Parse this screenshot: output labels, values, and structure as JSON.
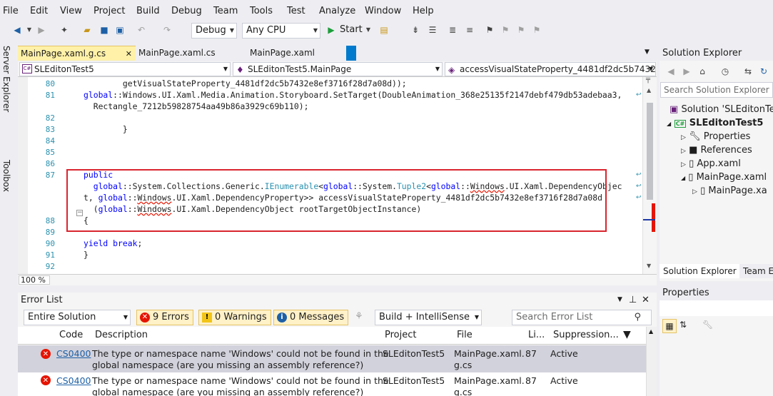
{
  "menu": [
    "File",
    "Edit",
    "View",
    "Project",
    "Build",
    "Debug",
    "Team",
    "Tools",
    "Test",
    "Analyze",
    "Window",
    "Help"
  ],
  "toolbar": {
    "config": "Debug",
    "platform": "Any CPU",
    "start_label": "Start"
  },
  "sidebar": {
    "server_explorer": "Server Explorer",
    "toolbox": "Toolbox"
  },
  "tabs": [
    "MainPage.xaml.g.cs",
    "MainPage.xaml.cs",
    "MainPage.xaml"
  ],
  "nav": {
    "project": "SLEditonTest5",
    "class": "SLEditonTest5.MainPage",
    "member": "accessVisualStateProperty_4481df2dc5b7432"
  },
  "code": {
    "line_numbers": [
      "80",
      "81",
      "82",
      "83",
      "84",
      "85",
      "86",
      "87",
      "88",
      "89",
      "90",
      "91",
      "92"
    ],
    "l80": "        getVisualStateProperty_4481df2dc5b7432e8ef3716f28d7a08d));",
    "l81a_global": "global",
    "l81a_rest": "::Windows.UI.Xaml.Media.Animation.Storyboard.SetTarget(DoubleAnimation_368e25135f2147debf479db53adebaa3,",
    "l81b": "  Rectangle_7212b59828754aa49b86a3929c69b110);",
    "l83": "        }",
    "l87_public": "public",
    "l87b_global1": "global",
    "l87b_mid1": "::System.Collections.Generic.",
    "l87b_ienum": "IEnumerable",
    "l87b_lt": "<",
    "l87b_global2": "global",
    "l87b_mid2": "::System.",
    "l87b_tuple": "Tuple2",
    "l87b_lt2": "<",
    "l87b_global3": "global",
    "l87b_mid3": "::",
    "l87b_windows": "Windows",
    "l87b_tail": ".UI.Xaml.DependencyObjec",
    "l87c_t": "t, ",
    "l87c_global": "global",
    "l87c_mid": "::",
    "l87c_windows": "Windows",
    "l87c_tail": ".UI.Xaml.DependencyProperty>> accessVisualStateProperty_4481df2dc5b7432e8ef3716f28d7a08d",
    "l87d_open": "(",
    "l87d_global": "global",
    "l87d_mid": "::",
    "l87d_windows": "Windows",
    "l87d_tail": ".UI.Xaml.DependencyObject rootTargetObjectInstance)",
    "l88": "{",
    "l90_yield": "yield",
    "l90_break": "break",
    "l90_semi": ";",
    "l91": "}"
  },
  "zoom": "100 %",
  "error_list": {
    "title": "Error List",
    "scope": "Entire Solution",
    "errors_btn": "9 Errors",
    "warnings_btn": "0 Warnings",
    "messages_btn": "0 Messages",
    "build_filter": "Build + IntelliSense",
    "search_placeholder": "Search Error List",
    "columns": {
      "code": "Code",
      "description": "Description",
      "project": "Project",
      "file": "File",
      "line": "Li...",
      "suppression": "Suppression..."
    },
    "rows": [
      {
        "code": "CS0400",
        "desc1": "The type or namespace name 'Windows' could not be found in the",
        "desc2": "global namespace (are you missing an assembly reference?)",
        "project": "SLEditonTest5",
        "file1": "MainPage.xaml.",
        "file2": "g.cs",
        "line": "87",
        "suppression": "Active"
      },
      {
        "code": "CS0400",
        "desc1": "The type or namespace name 'Windows' could not be found in the",
        "desc2": "global namespace (are you missing an assembly reference?)",
        "project": "SLEditonTest5",
        "file1": "MainPage.xaml.",
        "file2": "g.cs",
        "line": "87",
        "suppression": "Active"
      }
    ]
  },
  "solution_explorer": {
    "title": "Solution Explorer",
    "search_placeholder": "Search Solution Explorer (",
    "items": [
      "Solution 'SLEditonTest5",
      "SLEditonTest5",
      "Properties",
      "References",
      "App.xaml",
      "MainPage.xaml",
      "MainPage.xa"
    ],
    "bottom_tabs": [
      "Solution Explorer",
      "Team E"
    ]
  },
  "properties": {
    "title": "Properties"
  },
  "colors": {
    "accent": "#007acc",
    "error": "#e51400",
    "highlight": "#d9252f",
    "keyword": "#0000ff",
    "type": "#2b91af"
  }
}
